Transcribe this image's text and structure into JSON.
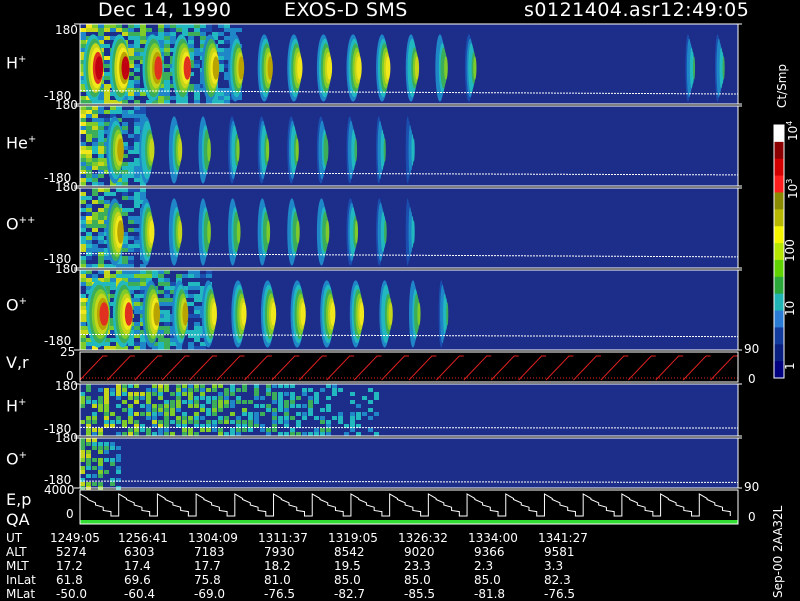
{
  "header": {
    "date": "Dec 14, 1990",
    "mission": "EXOS-D SMS",
    "file": "s0121404.asr",
    "time": "12:49:05"
  },
  "colorbar": {
    "unit_label": "Ct/Smp",
    "ticks": [
      {
        "label": "10",
        "sup": "4",
        "value": 10000
      },
      {
        "label": "10",
        "sup": "3",
        "value": 1000
      },
      {
        "label": "100",
        "sup": "",
        "value": 100
      },
      {
        "label": "10",
        "sup": "",
        "value": 10
      },
      {
        "label": "1",
        "sup": "",
        "value": 1
      }
    ],
    "colors": [
      "#ffffff",
      "#8b0000",
      "#d40000",
      "#ff1e1e",
      "#8a8a00",
      "#b8b800",
      "#f5f500",
      "#b4e600",
      "#5fd200",
      "#2aa83a",
      "#20b4b4",
      "#2a7bd6",
      "#143c9e",
      "#0a2080",
      "#000080"
    ]
  },
  "chart_data": [
    {
      "type": "heatmap",
      "species": "H",
      "charge": "+",
      "ylim": [
        -180,
        180
      ],
      "y_ticks": [
        "180",
        "-180"
      ],
      "bursts": [
        {
          "x": 0.005,
          "w": 0.03,
          "i": 1.0
        },
        {
          "x": 0.045,
          "w": 0.03,
          "i": 0.95
        },
        {
          "x": 0.095,
          "w": 0.03,
          "i": 0.9
        },
        {
          "x": 0.14,
          "w": 0.028,
          "i": 0.85
        },
        {
          "x": 0.185,
          "w": 0.025,
          "i": 0.8
        },
        {
          "x": 0.225,
          "w": 0.022,
          "i": 0.75
        },
        {
          "x": 0.27,
          "w": 0.02,
          "i": 0.75
        },
        {
          "x": 0.315,
          "w": 0.02,
          "i": 0.72
        },
        {
          "x": 0.36,
          "w": 0.02,
          "i": 0.7
        },
        {
          "x": 0.405,
          "w": 0.02,
          "i": 0.7
        },
        {
          "x": 0.45,
          "w": 0.018,
          "i": 0.68
        },
        {
          "x": 0.495,
          "w": 0.016,
          "i": 0.6
        },
        {
          "x": 0.54,
          "w": 0.014,
          "i": 0.5
        },
        {
          "x": 0.585,
          "w": 0.012,
          "i": 0.45
        },
        {
          "x": 0.92,
          "w": 0.008,
          "i": 0.35
        },
        {
          "x": 0.965,
          "w": 0.008,
          "i": 0.35
        }
      ],
      "dense_until": 0.24,
      "trace": [
        -120,
        -135
      ]
    },
    {
      "type": "heatmap",
      "species": "He",
      "charge": "+",
      "ylim": [
        -180,
        180
      ],
      "y_ticks": [
        "180",
        "-180"
      ],
      "bursts": [
        {
          "x": 0.04,
          "w": 0.025,
          "i": 0.75
        },
        {
          "x": 0.09,
          "w": 0.02,
          "i": 0.6
        },
        {
          "x": 0.135,
          "w": 0.016,
          "i": 0.55
        },
        {
          "x": 0.18,
          "w": 0.014,
          "i": 0.5
        },
        {
          "x": 0.225,
          "w": 0.012,
          "i": 0.45
        },
        {
          "x": 0.27,
          "w": 0.012,
          "i": 0.45
        },
        {
          "x": 0.315,
          "w": 0.012,
          "i": 0.45
        },
        {
          "x": 0.36,
          "w": 0.012,
          "i": 0.42
        },
        {
          "x": 0.405,
          "w": 0.01,
          "i": 0.4
        },
        {
          "x": 0.45,
          "w": 0.008,
          "i": 0.35
        },
        {
          "x": 0.495,
          "w": 0.005,
          "i": 0.3
        }
      ],
      "dense_until": 0.1,
      "trace": [
        -120,
        -130
      ]
    },
    {
      "type": "heatmap",
      "species": "O",
      "charge": "++",
      "ylim": [
        -180,
        180
      ],
      "y_ticks": [
        "180",
        "-180"
      ],
      "bursts": [
        {
          "x": 0.04,
          "w": 0.025,
          "i": 0.8
        },
        {
          "x": 0.09,
          "w": 0.02,
          "i": 0.65
        },
        {
          "x": 0.135,
          "w": 0.016,
          "i": 0.55
        },
        {
          "x": 0.18,
          "w": 0.014,
          "i": 0.5
        },
        {
          "x": 0.225,
          "w": 0.014,
          "i": 0.5
        },
        {
          "x": 0.27,
          "w": 0.014,
          "i": 0.5
        },
        {
          "x": 0.315,
          "w": 0.014,
          "i": 0.5
        },
        {
          "x": 0.36,
          "w": 0.014,
          "i": 0.5
        },
        {
          "x": 0.405,
          "w": 0.012,
          "i": 0.45
        },
        {
          "x": 0.45,
          "w": 0.01,
          "i": 0.4
        },
        {
          "x": 0.495,
          "w": 0.006,
          "i": 0.3
        }
      ],
      "dense_until": 0.1,
      "trace": [
        -115,
        -130
      ]
    },
    {
      "type": "heatmap",
      "species": "O",
      "charge": "+",
      "ylim": [
        -180,
        180
      ],
      "y_ticks": [
        "180",
        "-180"
      ],
      "bursts": [
        {
          "x": 0.01,
          "w": 0.035,
          "i": 0.9
        },
        {
          "x": 0.05,
          "w": 0.03,
          "i": 0.85
        },
        {
          "x": 0.095,
          "w": 0.025,
          "i": 0.8
        },
        {
          "x": 0.14,
          "w": 0.022,
          "i": 0.75
        },
        {
          "x": 0.185,
          "w": 0.02,
          "i": 0.7
        },
        {
          "x": 0.23,
          "w": 0.02,
          "i": 0.7
        },
        {
          "x": 0.275,
          "w": 0.02,
          "i": 0.7
        },
        {
          "x": 0.32,
          "w": 0.02,
          "i": 0.72
        },
        {
          "x": 0.365,
          "w": 0.02,
          "i": 0.7
        },
        {
          "x": 0.41,
          "w": 0.018,
          "i": 0.68
        },
        {
          "x": 0.455,
          "w": 0.016,
          "i": 0.6
        },
        {
          "x": 0.5,
          "w": 0.012,
          "i": 0.5
        },
        {
          "x": 0.545,
          "w": 0.008,
          "i": 0.4
        }
      ],
      "dense_until": 0.2,
      "trace": [
        -110,
        -120
      ]
    },
    {
      "type": "line",
      "label": "V,r",
      "y_ticks": [
        "25",
        "0"
      ],
      "right_ticks": [
        "90",
        "0"
      ],
      "sawtooth_cycles": 24
    },
    {
      "type": "heatmap",
      "species": "H",
      "charge": "+",
      "ylim": [
        -180,
        180
      ],
      "y_ticks": [
        "180",
        "-180"
      ],
      "patches_until": 0.45,
      "trace": [
        -120,
        -125
      ]
    },
    {
      "type": "heatmap",
      "species": "O",
      "charge": "+",
      "ylim": [
        -180,
        180
      ],
      "y_ticks": [
        "180",
        "-180"
      ],
      "patches_until": 0.06,
      "trace": [
        -130,
        -140
      ]
    },
    {
      "type": "line",
      "label": "E,p",
      "label2": "QA",
      "y_ticks": [
        "4000",
        "0"
      ],
      "right_ticks": [
        "90",
        "0"
      ],
      "staircase_cycles": 17
    }
  ],
  "table": {
    "rows": [
      {
        "name": "UT",
        "values": [
          "1249:05",
          "1256:41",
          "1304:09",
          "1311:37",
          "1319:05",
          "1326:32",
          "1334:00",
          "1341:27"
        ]
      },
      {
        "name": "ALT",
        "values": [
          "5274",
          "6303",
          "7183",
          "7930",
          "8542",
          "9020",
          "9366",
          "9581"
        ]
      },
      {
        "name": "MLT",
        "values": [
          "17.2",
          "17.4",
          "17.7",
          "18.2",
          "19.5",
          "23.3",
          "2.3",
          "3.3"
        ]
      },
      {
        "name": "InLat",
        "values": [
          "61.8",
          "69.6",
          "75.8",
          "81.0",
          "85.0",
          "85.0",
          "85.0",
          "82.3"
        ]
      },
      {
        "name": "MLat",
        "values": [
          "-50.0",
          "-60.4",
          "-69.0",
          "-76.5",
          "-82.7",
          "-85.5",
          "-81.8",
          "-76.5"
        ]
      }
    ]
  },
  "footer": {
    "code": "Sep-00 2AA32L"
  }
}
